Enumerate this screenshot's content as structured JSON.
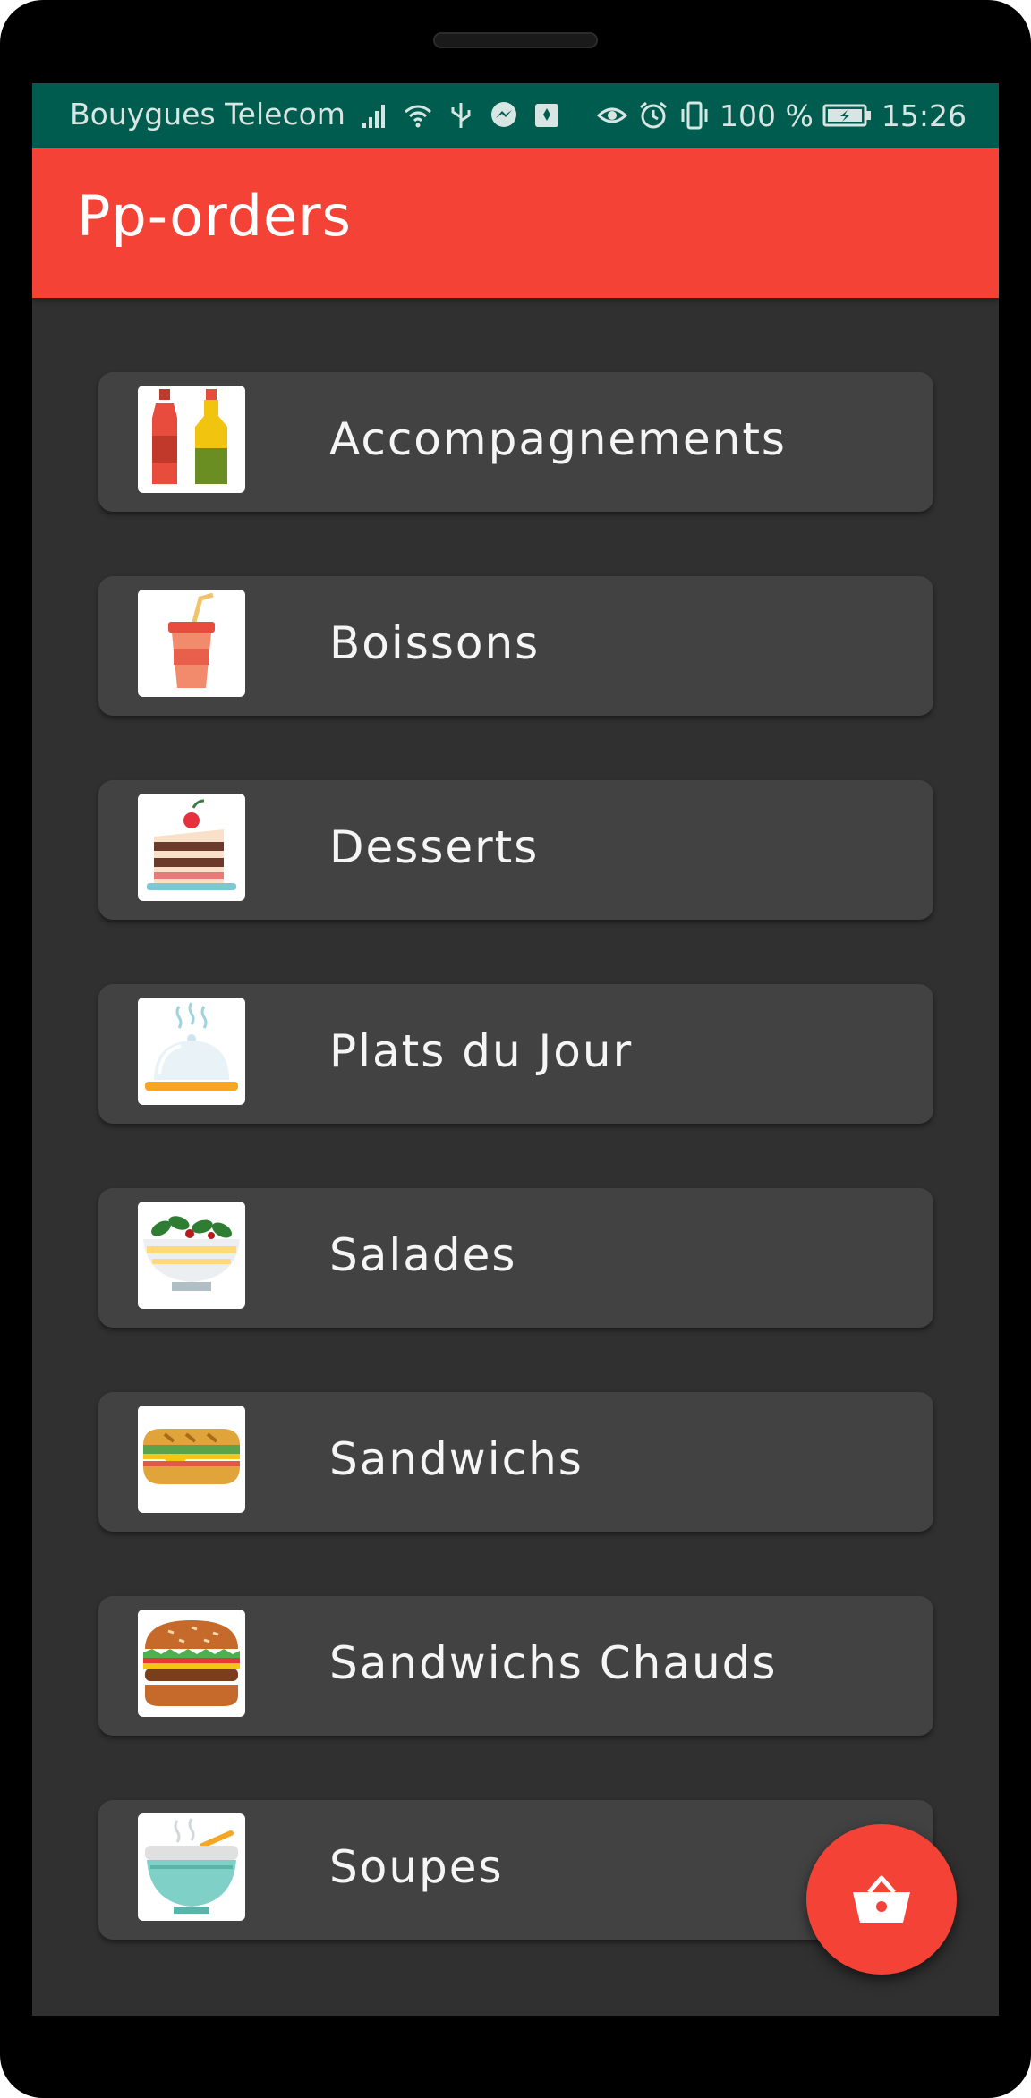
{
  "status_bar": {
    "carrier": "Bouygues Telecom",
    "battery": "100 %",
    "time": "15:26",
    "icons": [
      "signal-icon",
      "wifi-icon",
      "usb-icon",
      "messenger-icon",
      "notification-icon",
      "eye-icon",
      "alarm-icon",
      "vibrate-icon",
      "battery-charging-icon"
    ]
  },
  "app_bar": {
    "title": "Pp-orders"
  },
  "categories": [
    {
      "label": "Accompagnements",
      "icon": "sauce-bottles-icon"
    },
    {
      "label": "Boissons",
      "icon": "drink-cup-icon"
    },
    {
      "label": "Desserts",
      "icon": "cake-icon"
    },
    {
      "label": "Plats du Jour",
      "icon": "cloche-icon"
    },
    {
      "label": "Salades",
      "icon": "salad-bowl-icon"
    },
    {
      "label": "Sandwichs",
      "icon": "sandwich-icon"
    },
    {
      "label": "Sandwichs Chauds",
      "icon": "burger-icon"
    },
    {
      "label": "Soupes",
      "icon": "soup-bowl-icon"
    }
  ],
  "fab": {
    "icon": "basket-icon"
  },
  "colors": {
    "primary": "#f44336",
    "status_bar": "#005c4e",
    "background": "#303030",
    "card": "#424242"
  }
}
